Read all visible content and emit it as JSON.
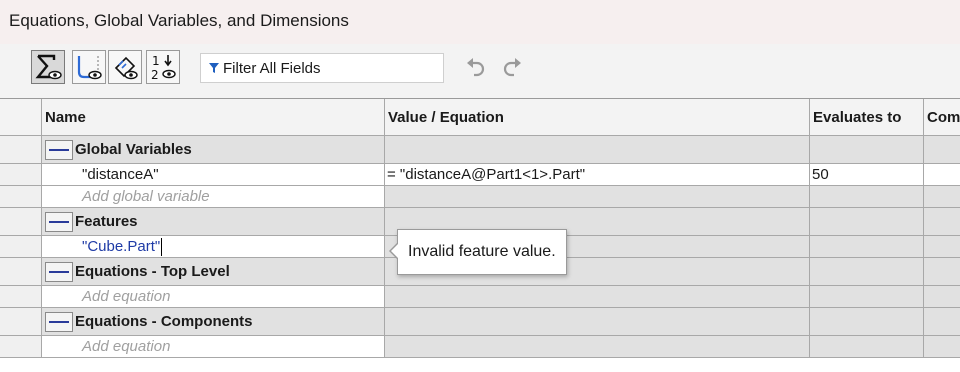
{
  "window": {
    "title": "Equations, Global Variables, and Dimensions"
  },
  "toolbar": {
    "buttons": [
      {
        "icon": "sigma-view-icon",
        "active": true
      },
      {
        "icon": "sketch-view-icon",
        "active": false
      },
      {
        "icon": "dimension-view-icon",
        "active": false
      },
      {
        "icon": "ordered-view-icon",
        "active": false
      }
    ],
    "filter_label": "Filter All Fields",
    "undo_icon": "undo-icon",
    "redo_icon": "redo-icon"
  },
  "table": {
    "headers": [
      "Name",
      "Value / Equation",
      "Evaluates to",
      "Com"
    ],
    "groups": {
      "global_variables": {
        "label": "Global Variables",
        "rows": [
          {
            "name": "\"distanceA\"",
            "value": "= \"distanceA@Part1<1>.Part\"",
            "evaluates": "50"
          }
        ],
        "add_placeholder": "Add global variable"
      },
      "features": {
        "label": "Features",
        "editing_value": "\"Cube.Part\""
      },
      "equations_top": {
        "label": "Equations - Top Level",
        "add_placeholder": "Add equation"
      },
      "equations_components": {
        "label": "Equations - Components",
        "add_placeholder": "Add equation"
      }
    }
  },
  "tooltip": {
    "text": "Invalid feature value."
  }
}
